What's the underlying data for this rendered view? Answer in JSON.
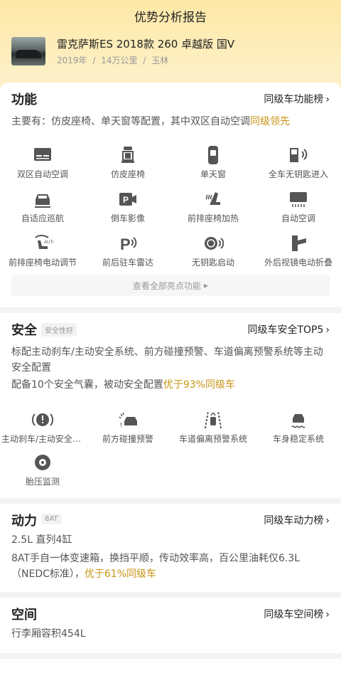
{
  "header": {
    "title": "优势分析报告"
  },
  "car": {
    "title": "雷克萨斯ES 2018款 260 卓越版 国V",
    "year": "2019年",
    "mileage": "14万公里",
    "city": "玉林",
    "sep": "/"
  },
  "function": {
    "title": "功能",
    "link": "同级车功能榜",
    "desc_main": "主要有：仿皮座椅、单天窗等配置，其中双区自动空调",
    "desc_hl": "同级领先",
    "items": [
      {
        "label": "双区自动空调",
        "icon": "dual-zone-ac-icon"
      },
      {
        "label": "仿皮座椅",
        "icon": "leather-seat-icon"
      },
      {
        "label": "单天窗",
        "icon": "sunroof-icon"
      },
      {
        "label": "全车无钥匙进入",
        "icon": "keyless-entry-icon"
      },
      {
        "label": "自适应巡航",
        "icon": "adaptive-cruise-icon"
      },
      {
        "label": "倒车影像",
        "icon": "reverse-camera-icon"
      },
      {
        "label": "前排座椅加热",
        "icon": "seat-heating-icon"
      },
      {
        "label": "自动空调",
        "icon": "auto-ac-icon"
      },
      {
        "label": "前排座椅电动调节",
        "icon": "power-seat-icon"
      },
      {
        "label": "前后驻车雷达",
        "icon": "parking-radar-icon"
      },
      {
        "label": "无钥匙启动",
        "icon": "keyless-start-icon"
      },
      {
        "label": "外后视镜电动折叠",
        "icon": "mirror-fold-icon"
      }
    ],
    "more": "查看全部亮点功能"
  },
  "safety": {
    "title": "安全",
    "tag": "安全性好",
    "link": "同级车安全TOP5",
    "desc1": "标配主动刹车/主动安全系统、前方碰撞预警、车道偏离预警系统等主动安全配置",
    "desc2_main": "配备10个安全气囊，被动安全配置",
    "desc2_hl": "优于93%同级车",
    "items": [
      {
        "label": "主动刹车/主动安全系统",
        "icon": "active-brake-icon"
      },
      {
        "label": "前方碰撞预警",
        "icon": "collision-warning-icon"
      },
      {
        "label": "车道偏离预警系统",
        "icon": "lane-departure-icon"
      },
      {
        "label": "车身稳定系统",
        "icon": "stability-control-icon"
      },
      {
        "label": "胎压监测",
        "icon": "tire-pressure-icon"
      }
    ]
  },
  "power": {
    "title": "动力",
    "tag": "8AT",
    "link": "同级车动力榜",
    "engine": "2.5L 直列4缸",
    "desc_main": "8AT手自一体变速箱，换挡平顺，传动效率高，百公里油耗仅6.3L（NEDC标准），",
    "desc_hl": "优于61%同级车"
  },
  "space": {
    "title": "空间",
    "link": "同级车空间榜",
    "desc": "行李厢容积454L"
  },
  "colors": {
    "accent": "#c89412",
    "icon": "#555555",
    "header_bg": "#fde8a5"
  }
}
